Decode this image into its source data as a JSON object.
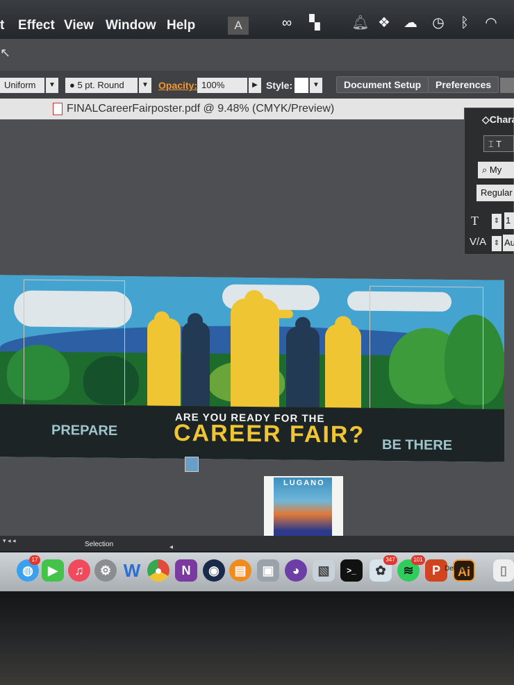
{
  "menubar": {
    "items": [
      "t",
      "Effect",
      "View",
      "Window",
      "Help"
    ],
    "tray_icons": [
      "illustrator-icon",
      "creative-cloud-icon",
      "grid-icon",
      "bell-icon",
      "dropbox-icon",
      "cloud-home-icon",
      "clock-icon",
      "bluetooth-icon",
      "wifi-icon"
    ]
  },
  "control_bar": {
    "stroke_profile": "Uniform",
    "brush": "5 pt. Round",
    "opacity_label": "Opacity:",
    "opacity_value": "100%",
    "style_label": "Style:",
    "document_setup": "Document Setup",
    "preferences": "Preferences"
  },
  "document": {
    "title": "FINALCareerFairposter.pdf @ 9.48% (CMYK/Preview)"
  },
  "character_panel": {
    "title": "Chara",
    "font_search": "My",
    "font_style": "Regular",
    "size_value": "1",
    "tracking_value": "Au"
  },
  "poster": {
    "left_label": "PREPARE",
    "headline_small": "ARE YOU READY FOR THE",
    "headline_large": "CAREER FAIR?",
    "right_label": "BE THERE"
  },
  "thumbnail": {
    "title": "LUGANO"
  },
  "status": {
    "tool": "Selection",
    "details": "Details"
  },
  "dock": {
    "badges": {
      "messages": "17",
      "photos": "347",
      "spotify": "101"
    },
    "ai_label": "Ai"
  },
  "colors": {
    "poster_yellow": "#f0c533",
    "poster_navy": "#233a55",
    "sky": "#8fd3e8",
    "opacity_orange": "#f29a2e"
  }
}
